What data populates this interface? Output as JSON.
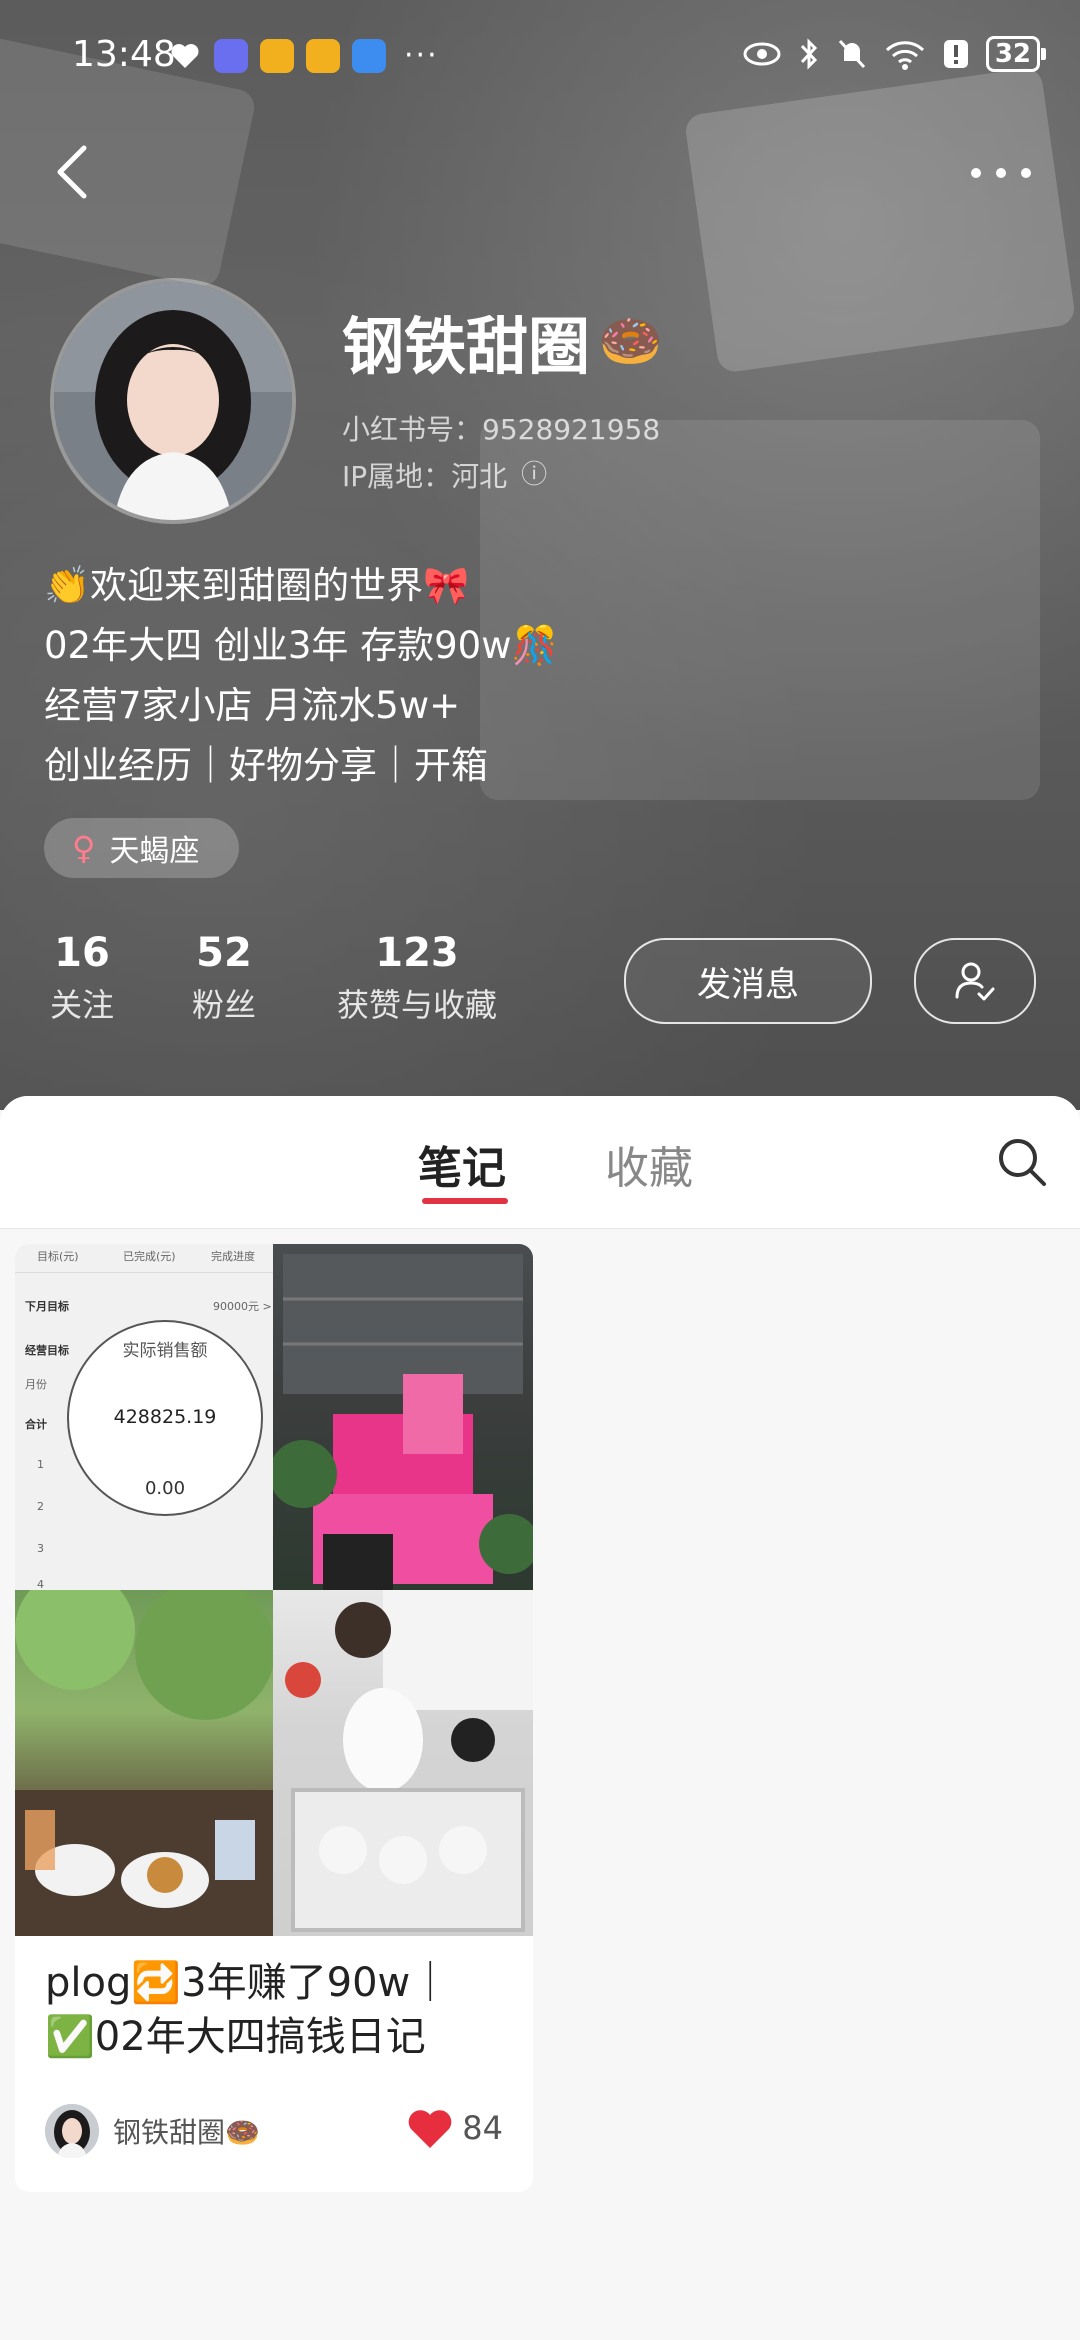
{
  "status_bar": {
    "time": "13:48",
    "more_indicator": "···",
    "battery": "32",
    "icons": [
      "heart-app-icon",
      "taobao-icon",
      "weibo-icon",
      "weibo-icon",
      "cloud-icon",
      "eye-icon",
      "bluetooth-icon",
      "mute-icon",
      "wifi-icon",
      "alert-icon"
    ]
  },
  "profile": {
    "nickname": "钢铁甜圈",
    "nickname_emoji": "🍩",
    "id_label": "小红书号：9528921958",
    "ip_label": "IP属地：河北",
    "info_icon": "ⓘ",
    "bio": [
      "👏欢迎来到甜圈的世界🎀",
      "02年大四 创业3年 存款90w🎊",
      "经营7家小店 月流水5w+",
      "创业经历｜好物分享｜开箱"
    ],
    "zodiac_symbol": "♀",
    "zodiac": "天蝎座"
  },
  "stats": [
    {
      "value": "16",
      "label": "关注"
    },
    {
      "value": "52",
      "label": "粉丝"
    },
    {
      "value": "123",
      "label": "获赞与收藏"
    }
  ],
  "actions": {
    "message": "发消息",
    "follow_icon": "user-check-icon"
  },
  "tabs": {
    "notes": "笔记",
    "collections": "收藏",
    "search_icon": "search-icon"
  },
  "note_card": {
    "cover_sheet_header": [
      "目标(元)",
      "已完成(元)",
      "完成进度"
    ],
    "cover_sheet_rows": [
      "下月目标",
      "经营目标",
      "月份",
      "合计",
      "1",
      "2",
      "3",
      "4"
    ],
    "cover_sheet_value": "90000元 >",
    "magnifier_title": "实际销售额",
    "magnifier_value": "428825.19",
    "magnifier_zero": "0.00",
    "title_lines": [
      "plog🔁3年赚了90w｜",
      "✅02年大四搞钱日记"
    ],
    "author": "钢铁甜圈🍩",
    "likes": "84"
  },
  "colors": {
    "accent": "#e03344",
    "like": "#e62e3f"
  }
}
